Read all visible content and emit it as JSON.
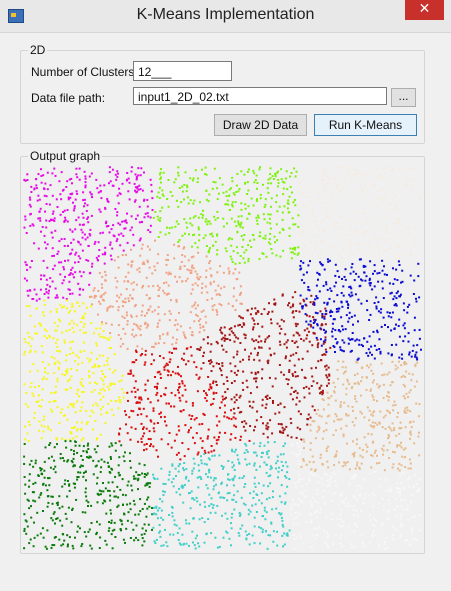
{
  "window": {
    "title": "K-Means Implementation",
    "close_glyph": "✕"
  },
  "group2d": {
    "title": "2D",
    "clusters_label": "Number of Clusters:",
    "clusters_value": "12___",
    "path_label": "Data file path:",
    "path_value": "input1_2D_02.txt",
    "browse_label": "...",
    "draw_label": "Draw 2D Data",
    "run_label": "Run K-Means"
  },
  "output": {
    "title": "Output graph"
  },
  "clusters": [
    {
      "color": "#e60be6"
    },
    {
      "color": "#7ef20c"
    },
    {
      "color": "#f4ece2"
    },
    {
      "color": "#f0a283"
    },
    {
      "color": "#a31515"
    },
    {
      "color": "#0a0ad4"
    },
    {
      "color": "#f7f71a"
    },
    {
      "color": "#d90d0d"
    },
    {
      "color": "#e7bb8d"
    },
    {
      "color": "#0a7a0a"
    },
    {
      "color": "#42cfc8"
    },
    {
      "color": "#f7f7f7"
    }
  ]
}
